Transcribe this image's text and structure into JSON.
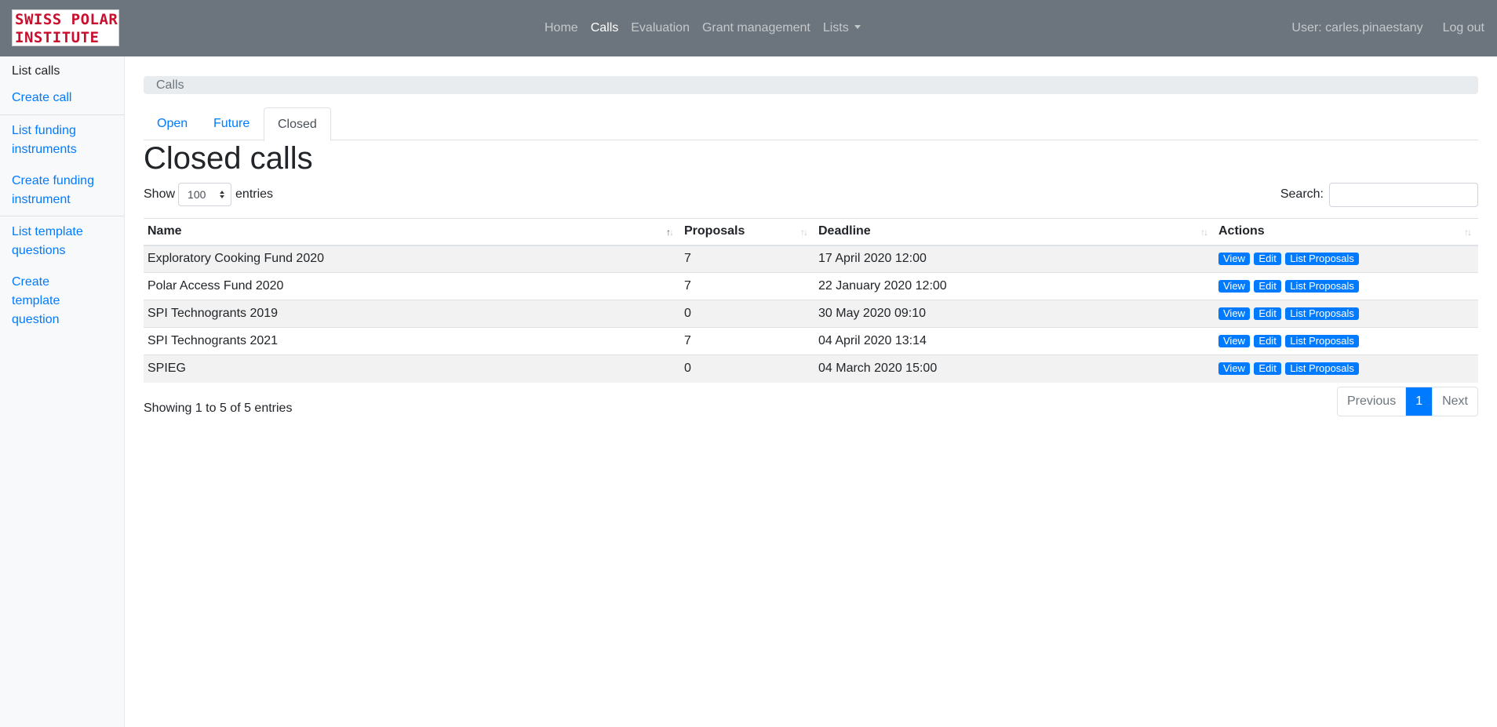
{
  "logo": {
    "line1": "SWISS POLAR",
    "line2": "INSTITUTE"
  },
  "nav": {
    "items": [
      {
        "label": "Home",
        "active": false
      },
      {
        "label": "Calls",
        "active": true
      },
      {
        "label": "Evaluation",
        "active": false
      },
      {
        "label": "Grant management",
        "active": false
      },
      {
        "label": "Lists",
        "active": false,
        "dropdown": true
      }
    ],
    "user": "User: carles.pinaestany",
    "logout": "Log out"
  },
  "sidebar": {
    "items": [
      {
        "label": "List calls",
        "current": true
      },
      {
        "label": "Create call"
      },
      {
        "label": "List funding instruments"
      },
      {
        "label": "Create funding instrument"
      },
      {
        "label": "List template questions"
      },
      {
        "label": "Create template question"
      }
    ]
  },
  "breadcrumb": "Calls",
  "tabs": [
    {
      "label": "Open",
      "active": false
    },
    {
      "label": "Future",
      "active": false
    },
    {
      "label": "Closed",
      "active": true
    }
  ],
  "page_title": "Closed calls",
  "length": {
    "prefix": "Show",
    "value": "100",
    "suffix": "entries"
  },
  "search": {
    "label": "Search:",
    "value": "",
    "placeholder": ""
  },
  "table": {
    "columns": [
      "Name",
      "Proposals",
      "Deadline",
      "Actions"
    ],
    "rows": [
      {
        "name": "Exploratory Cooking Fund 2020",
        "proposals": "7",
        "deadline": "17 April 2020 12:00"
      },
      {
        "name": "Polar Access Fund 2020",
        "proposals": "7",
        "deadline": "22 January 2020 12:00"
      },
      {
        "name": "SPI Technogrants 2019",
        "proposals": "0",
        "deadline": "30 May 2020 09:10"
      },
      {
        "name": "SPI Technogrants 2021",
        "proposals": "7",
        "deadline": "04 April 2020 13:14"
      },
      {
        "name": "SPIEG",
        "proposals": "0",
        "deadline": "04 March 2020 15:00"
      }
    ],
    "actions": [
      "View",
      "Edit",
      "List Proposals"
    ]
  },
  "info": "Showing 1 to 5 of 5 entries",
  "pager": {
    "previous": "Previous",
    "current": "1",
    "next": "Next"
  },
  "colors": {
    "navbar": "#6c757d",
    "link": "#007bff",
    "accent": "#007bff",
    "logo_text": "#c8102e"
  }
}
